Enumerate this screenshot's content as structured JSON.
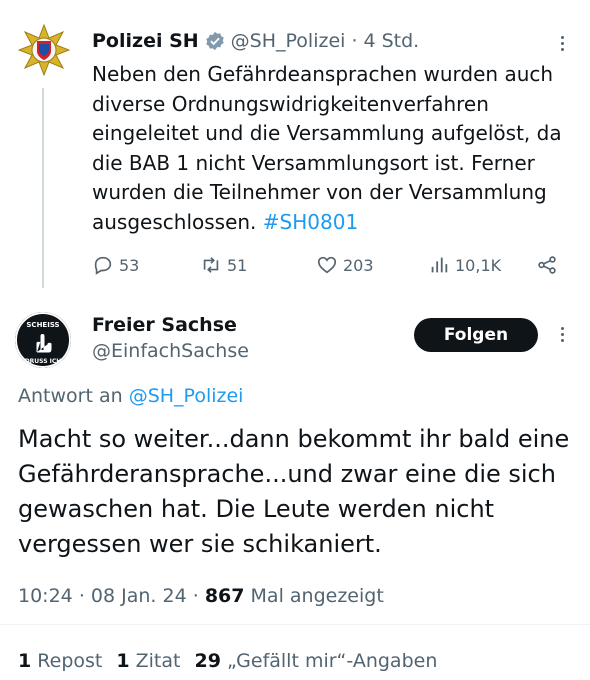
{
  "tweet1": {
    "author": {
      "name": "Polizei SH",
      "handle": "@SH_Polizei",
      "time": "4 Std."
    },
    "body": "Neben den Gefährdeansprachen wurden auch diverse Ordnungswidrigkeitenverfahren eingeleitet und die Versammlung aufgelöst, da die BAB 1 nicht Versammlungsort ist. Ferner wurden die Teilnehmer von der Versammlung ausgeschlossen.",
    "hashtag": "#SH0801",
    "actions": {
      "replies": "53",
      "reposts": "51",
      "likes": "203",
      "views": "10,1K"
    }
  },
  "tweet2": {
    "author": {
      "name": "Freier Sachse",
      "handle": "@EinfachSachse"
    },
    "follow_label": "Folgen",
    "reply_prefix": "Antwort an",
    "reply_to": "@SH_Polizei",
    "body": "Macht so weiter...dann bekommt ihr bald eine Gefährderansprache...und zwar eine die sich gewaschen hat. Die Leute werden nicht vergessen wer sie schikaniert.",
    "meta": {
      "time": "10:24",
      "date": "08 Jan. 24",
      "views": "867",
      "views_label": "Mal angezeigt"
    },
    "stats": {
      "reposts": "1",
      "reposts_label": "Repost",
      "quotes": "1",
      "quotes_label": "Zitat",
      "likes": "29",
      "likes_label": "„Gefällt mir“-Angaben"
    },
    "avatar_text": [
      "SCHEISS",
      "DRUSS ICH"
    ]
  },
  "colors": {
    "accent": "#1d9bf0",
    "text": "#0f1419",
    "muted": "#536471",
    "verified": "#829aab"
  }
}
